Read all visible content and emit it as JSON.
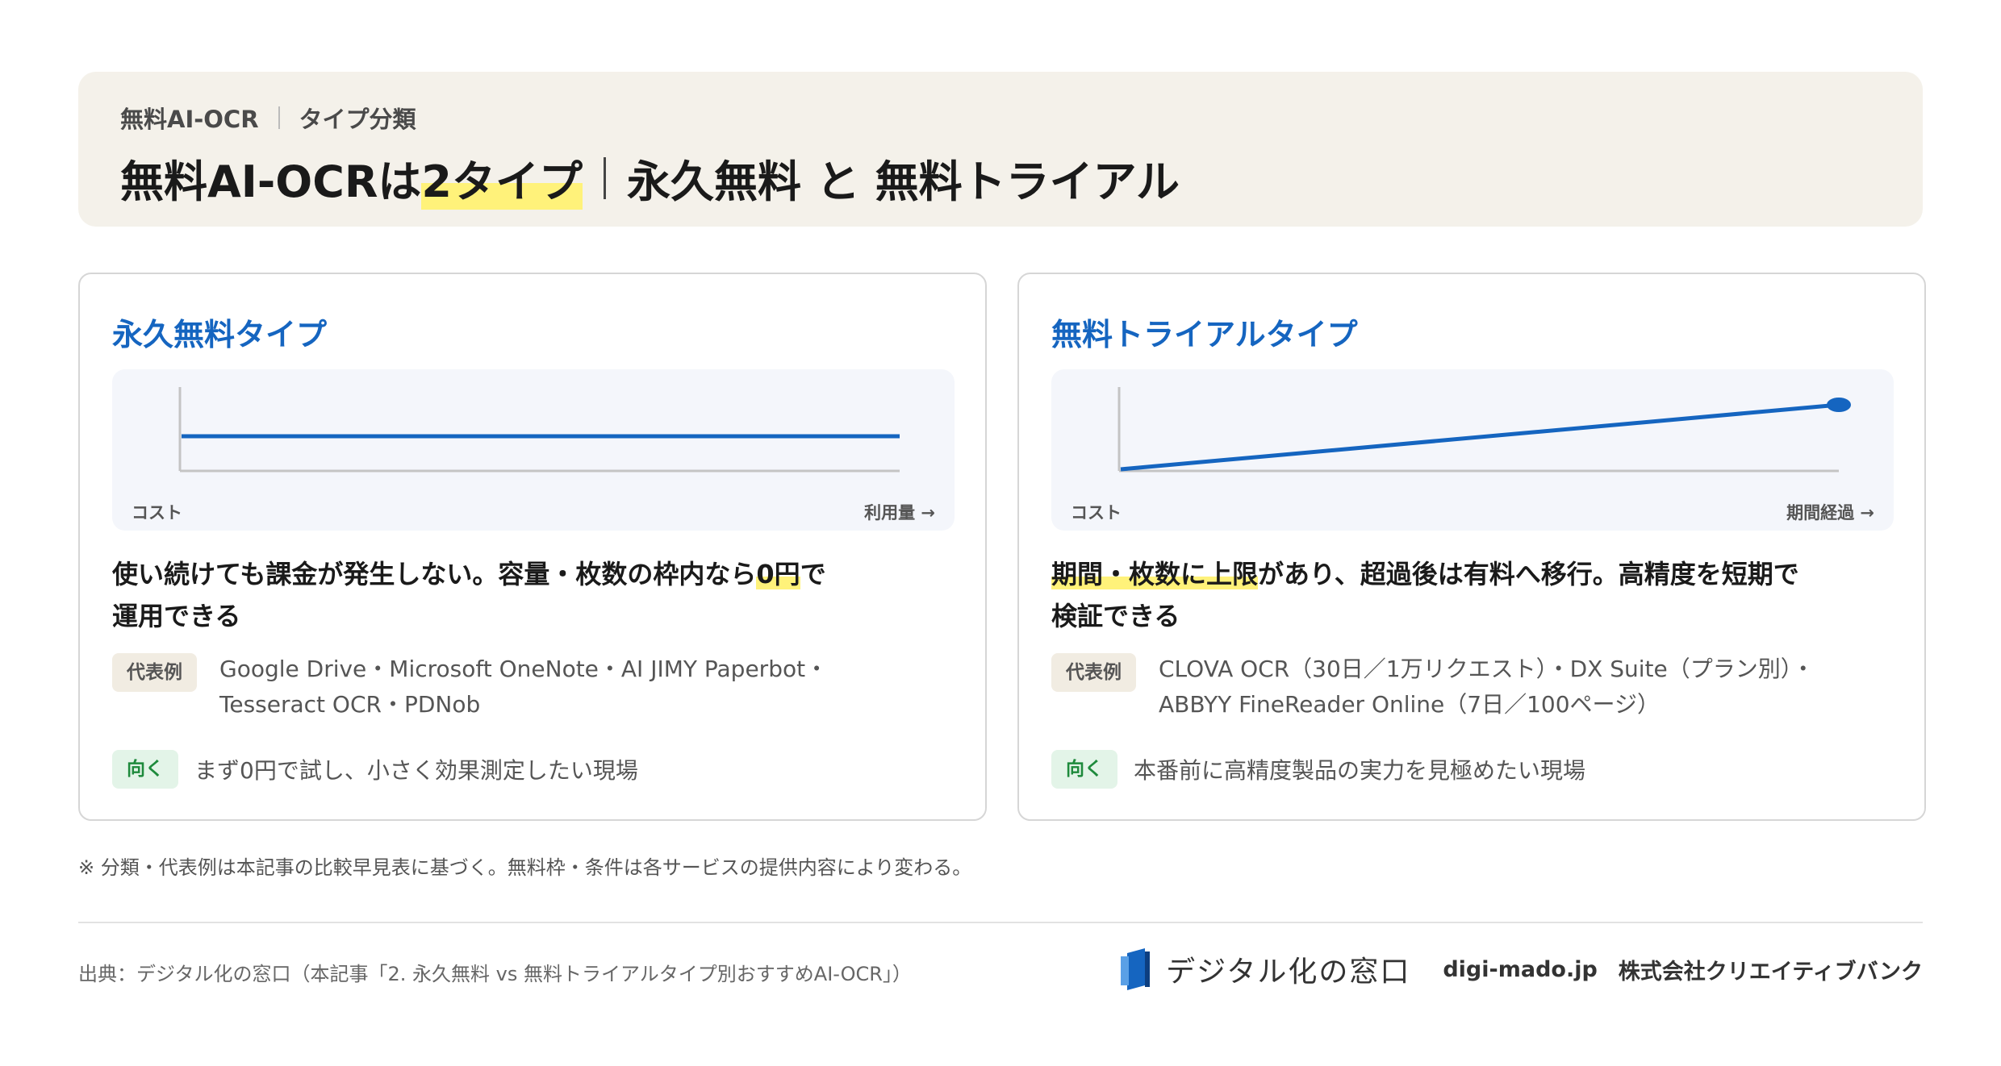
{
  "header": {
    "breadcrumb_left": "無料AI-OCR",
    "breadcrumb_right": "タイプ分類",
    "title_part1": "無料AI-OCRは",
    "title_highlight": "2タイプ",
    "title_part2": "永久無料 と 無料トライアル"
  },
  "cards": [
    {
      "title": "永久無料タイプ",
      "chart_y_label": "コスト",
      "chart_x_label": "利用量 →",
      "desc_line1_pre": "使い続けても課金が発生しない。容量・枚数の枠内なら",
      "desc_line1_highlight": "0円",
      "desc_line1_post": "で",
      "desc_line2": "運用できる",
      "example_badge": "代表例",
      "example_text": "Google Drive・Microsoft OneNote・AI JIMY Paperbot・Tesseract OCR・PDNob",
      "fit_badge": "向く",
      "fit_text": "まず0円で試し、小さく効果測定したい現場"
    },
    {
      "title": "無料トライアルタイプ",
      "chart_y_label": "コスト",
      "chart_x_label": "期間経過 →",
      "desc_line1_highlight": "期間・枚数に上限",
      "desc_line1_post": "があり、超過後は有料へ移行。高精度を短期で",
      "desc_line2": "検証できる",
      "example_badge": "代表例",
      "example_text": "CLOVA OCR（30日／1万リクエスト）・DX Suite（プラン別）・ABBYY FineReader Online（7日／100ページ）",
      "fit_badge": "向く",
      "fit_text": "本番前に高精度製品の実力を見極めたい現場"
    }
  ],
  "note": "※ 分類・代表例は本記事の比較早見表に基づく。無料枠・条件は各サービスの提供内容により変わる。",
  "footer": {
    "source": "出典：デジタル化の窓口（本記事「2. 永久無料 vs 無料トライアルタイプ別おすすめAI-OCR」）",
    "logo_text": "デジタル化の窓口",
    "domain": "digi-mado.jp",
    "company": "株式会社クリエイティブバンク"
  },
  "colors": {
    "accent_blue": "#1565c0",
    "highlight_yellow": "#fff27a",
    "header_bg": "#f4f1ea"
  }
}
